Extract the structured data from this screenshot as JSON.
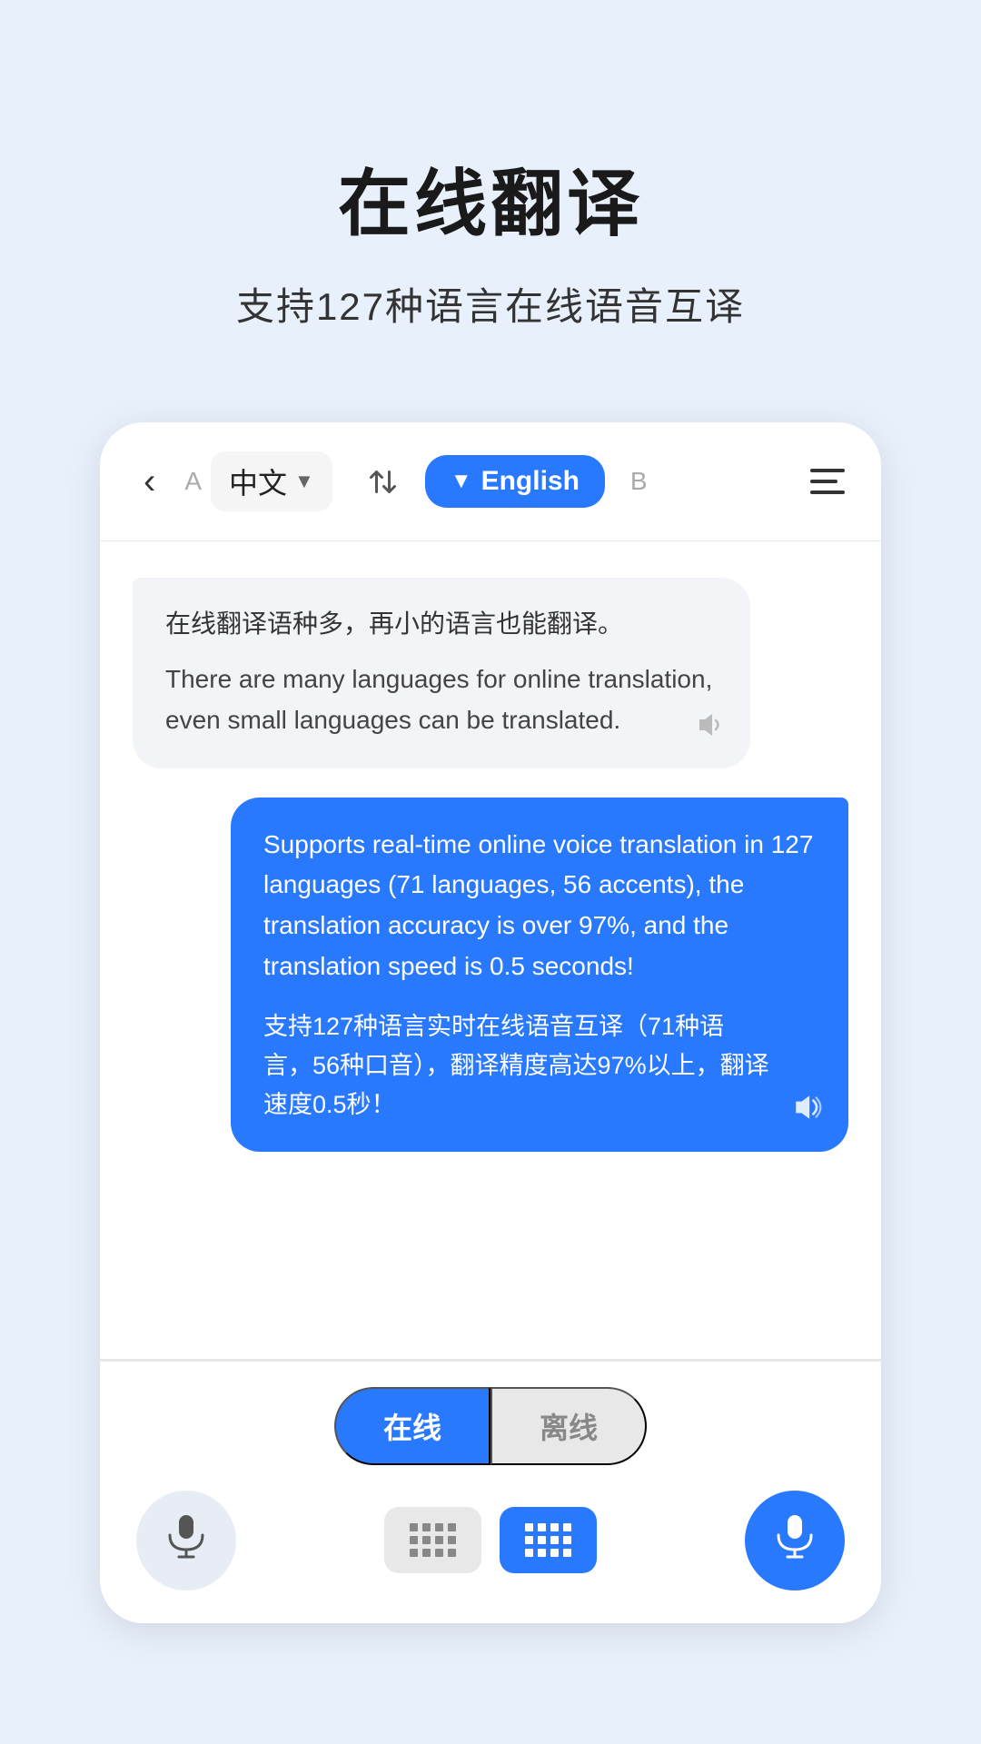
{
  "header": {
    "title": "在线翻译",
    "subtitle": "支持127种语言在线语音互译"
  },
  "navbar": {
    "back_label": "‹",
    "lang_a_label": "A",
    "lang_source": "中文",
    "swap_label": "⇄",
    "lang_target": "English",
    "lang_b_label": "B",
    "menu_label": "≡"
  },
  "chat": {
    "bubble_left": {
      "source": "在线翻译语种多，再小的语言也能翻译。",
      "translation": "There are many languages for online translation, even small languages can be translated."
    },
    "bubble_right": {
      "english": "Supports real-time online voice translation in 127 languages (71 languages, 56 accents), the translation accuracy is over 97%, and the translation speed is 0.5 seconds!",
      "chinese": "支持127种语言实时在线语音互译（71种语言，56种口音），翻译精度高达97%以上，翻译速度0.5秒！"
    }
  },
  "bottom": {
    "mode_online": "在线",
    "mode_offline": "离线"
  }
}
